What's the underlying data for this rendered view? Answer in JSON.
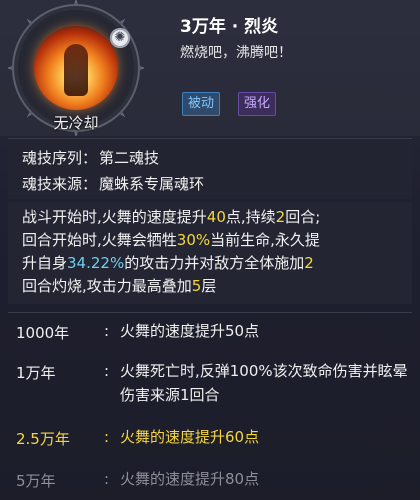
{
  "skill": {
    "title": "3万年 · 烈炎",
    "subtitle": "燃烧吧，沸腾吧！",
    "cooldown_label": "无冷却",
    "tags": [
      "被动",
      "强化"
    ]
  },
  "meta": {
    "order_label": "魂技序列：",
    "order_value": "第二魂技",
    "source_label": "魂技来源：",
    "source_value": "魔蛛系专属魂环"
  },
  "description": {
    "l1_a": "战斗开始时,火舞的速度提升",
    "l1_num": "40",
    "l1_b": "点,持续",
    "l1_num2": "2",
    "l1_c": "回合;",
    "l2_a": "回合开始时,火舞会牺牲",
    "l2_num": "30%",
    "l2_b": "当前生命,永久提",
    "l3_a": "升自身",
    "l3_num": "34.22%",
    "l3_b": "的攻击力并对敌方全体施加",
    "l3_num2": "2",
    "l4_a": "回合灼烧,攻击力最高叠加",
    "l4_num": "5",
    "l4_b": "层"
  },
  "years": [
    {
      "year": "1000年",
      "text": "火舞的速度提升50点"
    },
    {
      "year": "1万年",
      "text": "火舞死亡时,反弹100%该次致命伤害并眩晕伤害来源1回合"
    },
    {
      "year": "2.5万年",
      "text": "火舞的速度提升60点"
    },
    {
      "year": "5万年",
      "text": "火舞的速度提升80点"
    }
  ],
  "colors": {
    "highlight_yellow": "#f5d640",
    "highlight_blue": "#6fd0f0"
  }
}
